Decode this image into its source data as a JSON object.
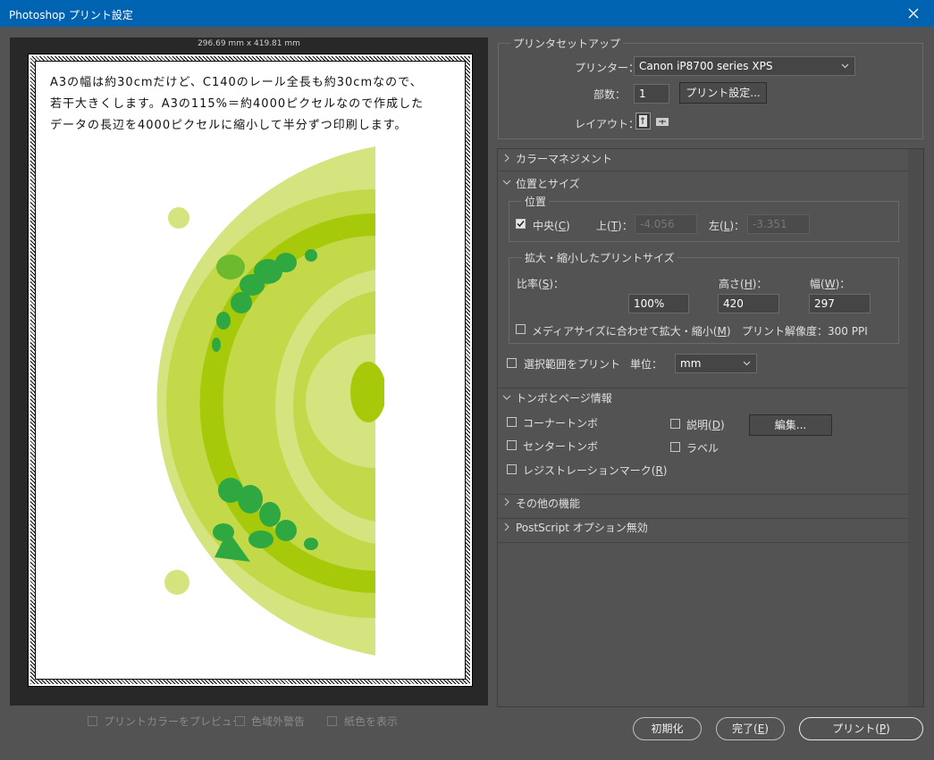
{
  "window": {
    "title": "Photoshop プリント設定"
  },
  "preview": {
    "dimensions": "296.69 mm x 419.81 mm",
    "note_lines": [
      "A3の幅は約30cmだけど、C140のレール全長も約30cmなので、",
      "若干大きくします。A3の115%＝約4000ピクセルなので作成した",
      "データの長辺を4000ピクセルに縮小して半分ずつ印刷します。"
    ],
    "options": {
      "preview_color": "プリントカラーをプレビュー",
      "gamut_warning": "色域外警告",
      "paper_color": "紙色を表示"
    }
  },
  "setup": {
    "group_title": "プリンタセットアップ",
    "printer_label": "プリンター：",
    "printer_value": "Canon iP8700 series XPS",
    "copies_label": "部数：",
    "copies_value": "1",
    "print_settings_button": "プリント設定...",
    "layout_label": "レイアウト："
  },
  "sections": {
    "color_management": "カラーマネジメント",
    "position_size": "位置とサイズ",
    "marks": "トンボとページ情報",
    "other": "その他の機能",
    "postscript": "PostScript オプション無効"
  },
  "position": {
    "group_title": "位置",
    "center_label": "中央(",
    "center_key": "C",
    "close": ")",
    "top_label": "上(",
    "top_key": "T",
    "top_value": "-4.056",
    "left_label": "左(",
    "left_key": "L",
    "left_value": "-3.351",
    "label_suffix": ")："
  },
  "scaled": {
    "group_title": "拡大・縮小したプリントサイズ",
    "scale_label": "比率(",
    "scale_key": "S",
    "scale_value": "100%",
    "height_label": "高さ(",
    "height_key": "H",
    "height_value": "420",
    "width_label": "幅(",
    "width_key": "W",
    "width_value": "297",
    "label_suffix": ")：",
    "fit_media": "メディアサイズに合わせて拡大・縮小(",
    "fit_key": "M",
    "close": ")",
    "resolution": "プリント解像度：300 PPI"
  },
  "selection": {
    "print_selection": "選択範囲をプリント",
    "units_label": "単位：",
    "units_value": "mm"
  },
  "marks": {
    "corner": "コーナートンボ",
    "center": "センタートンボ",
    "registration": "レジストレーションマーク(",
    "registration_key": "R",
    "description": "説明(",
    "description_key": "D",
    "labels": "ラベル",
    "edit_button": "編集...",
    "close": ")"
  },
  "footer": {
    "reset": "初期化",
    "done": "完了(",
    "done_key": "E",
    "print": "プリント(",
    "print_key": "P",
    "close": ")"
  },
  "colors": {
    "titlebar": "#0063b1",
    "panel": "#535353",
    "preview_bg": "#282828",
    "lime_light": "#d5e47f",
    "lime_mid": "#c3d94a",
    "lime_dark": "#a6c90a",
    "green": "#2fa842"
  }
}
